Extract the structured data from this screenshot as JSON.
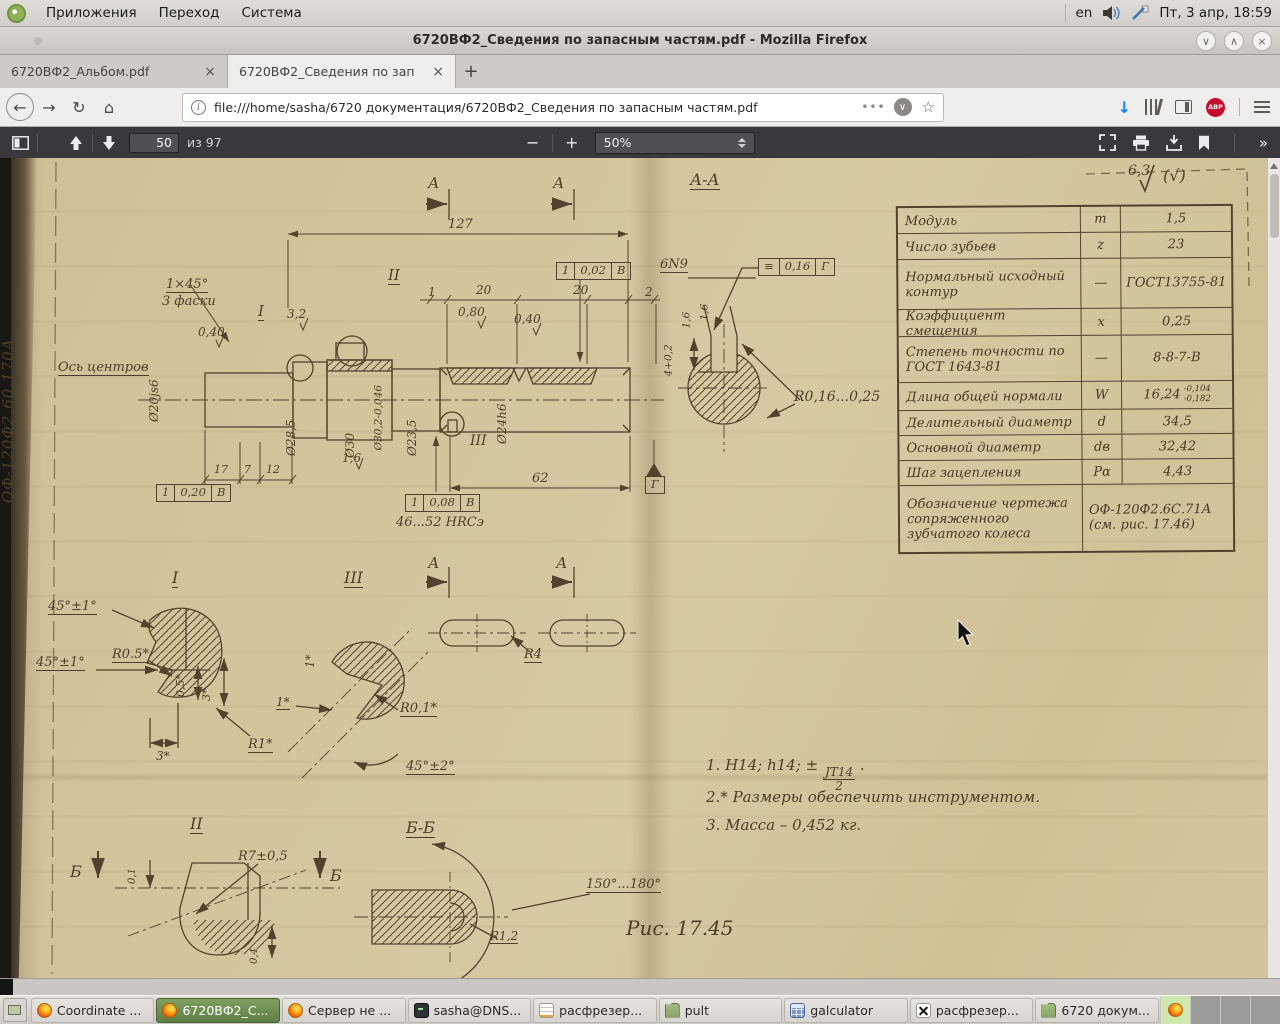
{
  "desktop": {
    "menus": {
      "m1": "Приложения",
      "m2": "Переход",
      "m3": "Система"
    },
    "tray": {
      "lang": "en",
      "clock": "Пт,  3 апр, 18:59"
    }
  },
  "titlebar": {
    "title": "6720ВФ2_Сведения по запасным частям.pdf - Mozilla Firefox",
    "min": "∨",
    "max": "∧",
    "close": "×"
  },
  "tabs": {
    "tab1": "6720ВФ2_Альбом.pdf",
    "tab2": "6720ВФ2_Сведения по зап",
    "close1": "×",
    "close2": "×",
    "newtab": "+"
  },
  "nav": {
    "url": "file:///home/sasha/6720 документация/6720ВФ2_Сведения по запасным частям.pdf",
    "dots": "•••",
    "back": "←",
    "forward": "→",
    "reload": "↻",
    "home": "⌂",
    "info": "i",
    "pocket": "∨",
    "star": "☆",
    "download": "↓",
    "abp": "ABP"
  },
  "pdf": {
    "page": "50",
    "of": "из 97",
    "zoom": "50%",
    "minus": "−",
    "plus": "+",
    "more": "»"
  },
  "drawing": {
    "labels": {
      "code_side": "ОФ-120Ф2.60.170А",
      "axis": "Ось центров",
      "secA": "А",
      "secAA": "А-А",
      "rough63": "6,3",
      "roughAll": "(√)",
      "d127": "127",
      "chamfer1": "1×45°",
      "chamfer2": "3 фаски",
      "det1": "І",
      "det2": "ІІ",
      "det3": "ІІІ",
      "r32": "3,2",
      "r080": "0,80",
      "r040": "0,40",
      "r040b": "0,40",
      "n1": "1",
      "n20a": "20",
      "n20b": "20",
      "n2": "2",
      "ft_a": "1",
      "ft_b": "0,02",
      "ft_c": "В",
      "fm_a": "1",
      "fm_b": "0,08",
      "fm_c": "В",
      "fl_a": "1",
      "fl_b": "0,20",
      "fl_c": "В",
      "dia20": "Ø20js6",
      "dia285": "Ø28,5",
      "dia30": "Ø30",
      "dia302": "Ø30,2-0,046",
      "dia235": "Ø23,5",
      "dia24": "Ø24h6",
      "n17": "17",
      "n7": "7",
      "n12": "12",
      "r16": "1,6",
      "hardness": "46...52 HRCэ",
      "n62": "62",
      "datumG": "Г",
      "key": "6N9",
      "sym_a": "≡",
      "sym_b": "0,16",
      "sym_c": "Г",
      "r16a": "1,6",
      "r16b": "1,6",
      "kdepth": "4+0,2",
      "rr": "R0,16...0,25",
      "d1_a45a": "45°±1°",
      "d1_a45b": "45°±1°",
      "d1_r05": "R0.5*",
      "d1_05": "0,5*",
      "d1_3v": "3*",
      "d1_3h": "3*",
      "d1_r1": "R1*",
      "d3_1a": "1*",
      "d3_1b": "1*",
      "d3_r01": "R0,1*",
      "d3_45": "45°±2°",
      "r4": "R4",
      "d2_b1": "Б",
      "d2_b2": "Б",
      "d2_r7": "R7±0,5",
      "d2_01": "0,1",
      "d2_04": "0,4",
      "bb": "Б-Б",
      "bb_angle": "150°...180°",
      "bb_r": "R1,2",
      "fig": "Рис. 17.45"
    },
    "notes": {
      "n1a": "1. Н14; h14; ±",
      "n1num": "JT14",
      "n1den": "2",
      "n1b": ".",
      "n2": "2.* Размеры обеспечить инструментом.",
      "n3": "3. Масса – 0,452 кг."
    },
    "table": {
      "rows": [
        {
          "name": "Модуль",
          "sym": "m",
          "val": "1,5"
        },
        {
          "name": "Число зубьев",
          "sym": "z",
          "val": "23"
        },
        {
          "name": "Нормальный исходный контур",
          "sym": "—",
          "val": "ГОСТ13755-81"
        },
        {
          "name": "Коэффициент смещения",
          "sym": "x",
          "val": "0,25"
        },
        {
          "name": "Степень точности по ГОСТ 1643-81",
          "sym": "—",
          "val": "8-8-7-В"
        },
        {
          "name": "Длина общей нормали",
          "sym": "W",
          "val": "16,24",
          "tol_top": "-0,104",
          "tol_bot": "-0,182"
        },
        {
          "name": "Делительный диаметр",
          "sym": "d",
          "val": "34,5"
        },
        {
          "name": "Основной диаметр",
          "sym": "dв",
          "val": "32,42"
        },
        {
          "name": "Шаг зацепления",
          "sym": "Pα",
          "val": "4,43"
        },
        {
          "name": "Обозначение чертежа сопряженного зубчатого колеса",
          "val1": "ОФ-120Ф2.6С.71А",
          "val2": "(см. рис. 17.46)"
        }
      ]
    }
  },
  "taskbar": {
    "items": [
      {
        "label": "Coordinate ..."
      },
      {
        "label": "6720ВФ2_С..."
      },
      {
        "label": "Сервер не ..."
      },
      {
        "label": "sasha@DNS..."
      },
      {
        "label": "расфрезер..."
      },
      {
        "label": "pult"
      },
      {
        "label": "galculator"
      },
      {
        "label": "расфрезер..."
      },
      {
        "label": "6720 докум..."
      }
    ]
  }
}
